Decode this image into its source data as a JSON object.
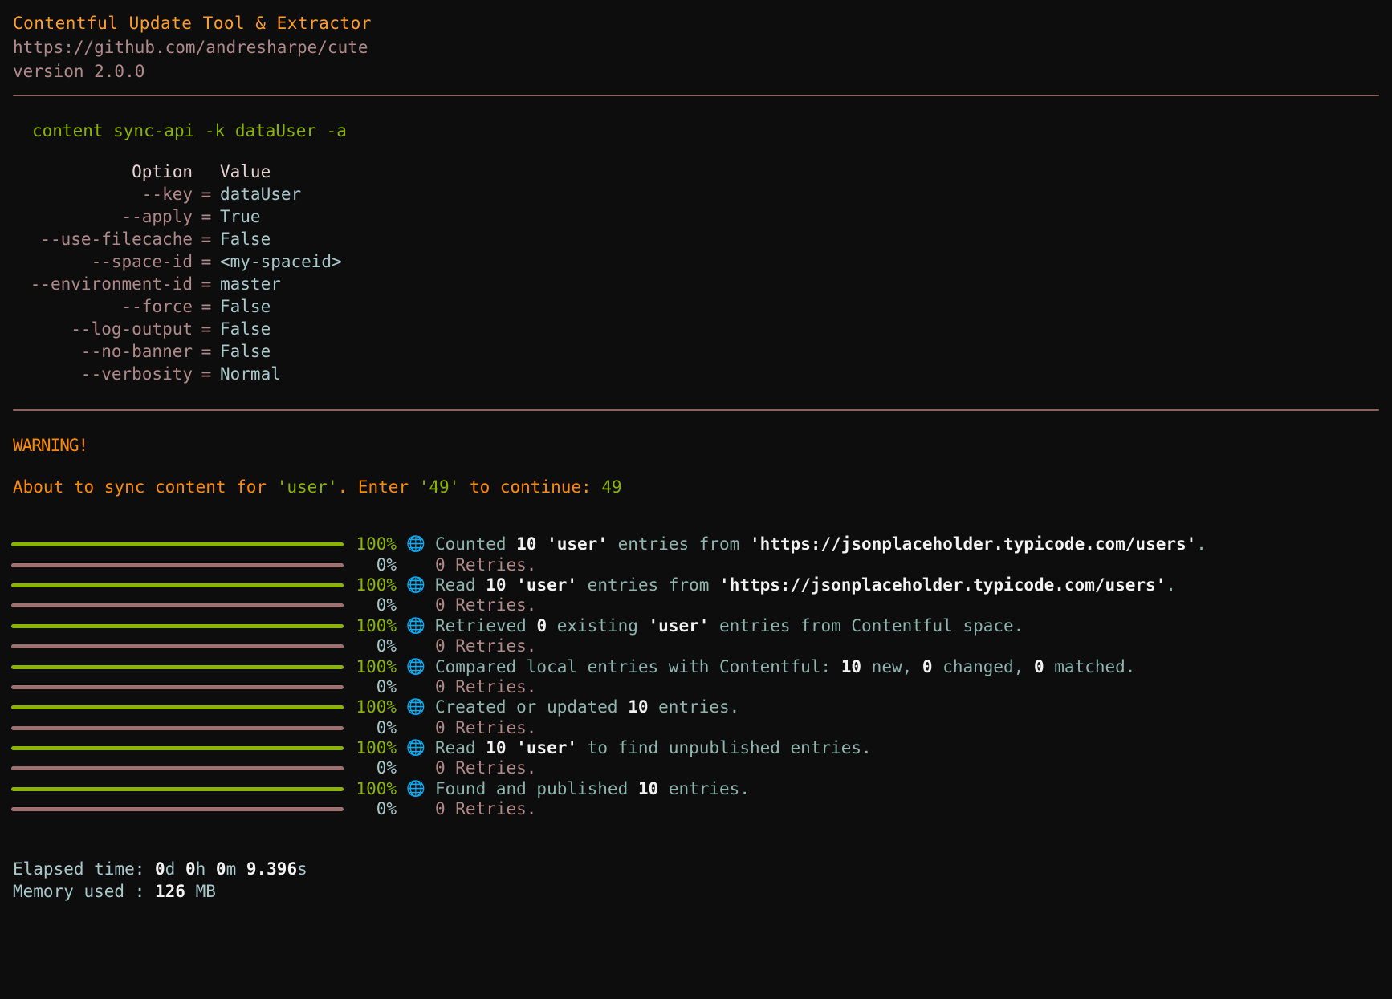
{
  "banner": {
    "title": "Contentful Update Tool & Extractor",
    "url": "https://github.com/andresharpe/cute",
    "version": "version 2.0.0"
  },
  "command": {
    "line": "content sync-api -k dataUser -a"
  },
  "options": {
    "header": {
      "name": "Option",
      "value": "Value"
    },
    "rows": [
      {
        "name": "--key",
        "eq": "=",
        "value": "dataUser"
      },
      {
        "name": "--apply",
        "eq": "=",
        "value": "True"
      },
      {
        "name": "--use-filecache",
        "eq": "=",
        "value": "False"
      },
      {
        "name": "--space-id",
        "eq": "=",
        "value": "<my-spaceid>"
      },
      {
        "name": "--environment-id",
        "eq": "=",
        "value": "master"
      },
      {
        "name": "--force",
        "eq": "=",
        "value": "False"
      },
      {
        "name": "--log-output",
        "eq": "=",
        "value": "False"
      },
      {
        "name": "--no-banner",
        "eq": "=",
        "value": "False"
      },
      {
        "name": "--verbosity",
        "eq": "=",
        "value": "Normal"
      }
    ]
  },
  "warning": {
    "label": "WARNING!",
    "prompt_prefix": "About to sync content for ",
    "prompt_entity": "'user'",
    "prompt_middle": ". Enter ",
    "prompt_code": "'49'",
    "prompt_suffix": " to continue: ",
    "answer": "49"
  },
  "progress": {
    "globe_icon": "🌐",
    "rows": [
      {
        "pct": "100%",
        "state": "done",
        "icon": true,
        "parts": [
          {
            "t": "Counted ",
            "b": false
          },
          {
            "t": "10",
            "b": true
          },
          {
            "t": " ",
            "b": false
          },
          {
            "t": "'user'",
            "b": true
          },
          {
            "t": " entries from ",
            "b": false
          },
          {
            "t": "'https://jsonplaceholder.typicode.com/users'",
            "b": true
          },
          {
            "t": ".",
            "b": false
          }
        ]
      },
      {
        "pct": "0%",
        "state": "idle",
        "icon": false,
        "parts": [
          {
            "t": "0 Retries.",
            "b": false
          }
        ]
      },
      {
        "pct": "100%",
        "state": "done",
        "icon": true,
        "parts": [
          {
            "t": "Read ",
            "b": false
          },
          {
            "t": "10",
            "b": true
          },
          {
            "t": " ",
            "b": false
          },
          {
            "t": "'user'",
            "b": true
          },
          {
            "t": " entries from ",
            "b": false
          },
          {
            "t": "'https://jsonplaceholder.typicode.com/users'",
            "b": true
          },
          {
            "t": ".",
            "b": false
          }
        ]
      },
      {
        "pct": "0%",
        "state": "idle",
        "icon": false,
        "parts": [
          {
            "t": "0 Retries.",
            "b": false
          }
        ]
      },
      {
        "pct": "100%",
        "state": "done",
        "icon": true,
        "parts": [
          {
            "t": "Retrieved ",
            "b": false
          },
          {
            "t": "0",
            "b": true
          },
          {
            "t": " existing ",
            "b": false
          },
          {
            "t": "'user'",
            "b": true
          },
          {
            "t": " entries from Contentful space.",
            "b": false
          }
        ]
      },
      {
        "pct": "0%",
        "state": "idle",
        "icon": false,
        "parts": [
          {
            "t": "0 Retries.",
            "b": false
          }
        ]
      },
      {
        "pct": "100%",
        "state": "done",
        "icon": true,
        "parts": [
          {
            "t": "Compared local entries with Contentful: ",
            "b": false
          },
          {
            "t": "10",
            "b": true
          },
          {
            "t": " new, ",
            "b": false
          },
          {
            "t": "0",
            "b": true
          },
          {
            "t": " changed, ",
            "b": false
          },
          {
            "t": "0",
            "b": true
          },
          {
            "t": " matched.",
            "b": false
          }
        ]
      },
      {
        "pct": "0%",
        "state": "idle",
        "icon": false,
        "parts": [
          {
            "t": "0 Retries.",
            "b": false
          }
        ]
      },
      {
        "pct": "100%",
        "state": "done",
        "icon": true,
        "parts": [
          {
            "t": "Created or updated ",
            "b": false
          },
          {
            "t": "10",
            "b": true
          },
          {
            "t": " entries.",
            "b": false
          }
        ]
      },
      {
        "pct": "0%",
        "state": "idle",
        "icon": false,
        "parts": [
          {
            "t": "0 Retries.",
            "b": false
          }
        ]
      },
      {
        "pct": "100%",
        "state": "done",
        "icon": true,
        "parts": [
          {
            "t": "Read ",
            "b": false
          },
          {
            "t": "10",
            "b": true
          },
          {
            "t": " ",
            "b": false
          },
          {
            "t": "'user'",
            "b": true
          },
          {
            "t": " to find unpublished entries.",
            "b": false
          }
        ]
      },
      {
        "pct": "0%",
        "state": "idle",
        "icon": false,
        "parts": [
          {
            "t": "0 Retries.",
            "b": false
          }
        ]
      },
      {
        "pct": "100%",
        "state": "done",
        "icon": true,
        "parts": [
          {
            "t": "Found and published ",
            "b": false
          },
          {
            "t": "10",
            "b": true
          },
          {
            "t": " entries.",
            "b": false
          }
        ]
      },
      {
        "pct": "0%",
        "state": "idle",
        "icon": false,
        "parts": [
          {
            "t": "0 Retries.",
            "b": false
          }
        ]
      }
    ]
  },
  "footer": {
    "lines": [
      [
        {
          "t": "Elapsed time: ",
          "b": false
        },
        {
          "t": "0",
          "b": true
        },
        {
          "t": "d ",
          "b": false
        },
        {
          "t": "0",
          "b": true
        },
        {
          "t": "h ",
          "b": false
        },
        {
          "t": "0",
          "b": true
        },
        {
          "t": "m ",
          "b": false
        },
        {
          "t": "9.396",
          "b": true
        },
        {
          "t": "s",
          "b": false
        }
      ],
      [
        {
          "t": "Memory used : ",
          "b": false
        },
        {
          "t": "126",
          "b": true
        },
        {
          "t": " MB",
          "b": false
        }
      ]
    ]
  },
  "colors": {
    "background": "#0d0d0d",
    "accent_orange": "#ff9e2c",
    "accent_green": "#8bb300",
    "muted_rose": "#b08a8a",
    "teal": "#a8c8cc",
    "globe_blue": "#7ab4e8"
  }
}
